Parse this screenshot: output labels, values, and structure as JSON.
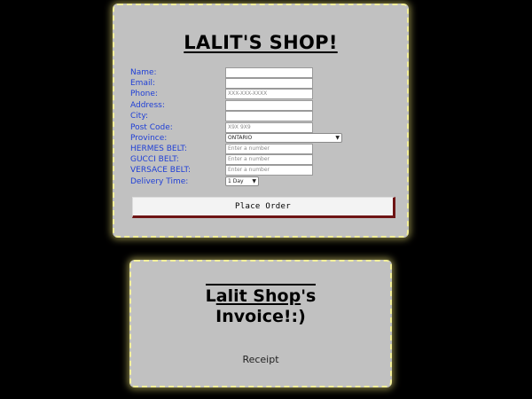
{
  "order_form": {
    "title": "LALIT'S SHOP!",
    "fields": [
      {
        "label": "Name:",
        "type": "text",
        "value": "",
        "placeholder": ""
      },
      {
        "label": "Email:",
        "type": "text",
        "value": "",
        "placeholder": ""
      },
      {
        "label": "Phone:",
        "type": "text",
        "value": "",
        "placeholder": "XXX-XXX-XXXX"
      },
      {
        "label": "Address:",
        "type": "text",
        "value": "",
        "placeholder": ""
      },
      {
        "label": "City:",
        "type": "text",
        "value": "",
        "placeholder": ""
      },
      {
        "label": "Post Code:",
        "type": "text",
        "value": "",
        "placeholder": "X9X 9X9"
      },
      {
        "label": "Province:",
        "type": "select",
        "value": "ONTARIO"
      },
      {
        "label": "HERMES BELT:",
        "type": "number",
        "value": "",
        "placeholder": "Enter a number"
      },
      {
        "label": "GUCCI BELT:",
        "type": "number",
        "value": "",
        "placeholder": "Enter a number"
      },
      {
        "label": "VERSACE BELT:",
        "type": "number",
        "value": "",
        "placeholder": "Enter a number"
      },
      {
        "label": "Delivery Time:",
        "type": "select",
        "value": "1 Day"
      }
    ],
    "submit_label": "Place Order"
  },
  "invoice": {
    "title_part1": "L",
    "title_part2": "alit Shop",
    "title_part3": "'s",
    "title_line2": "Invoice!:)",
    "receipt_label": "Receipt"
  },
  "colors": {
    "background": "#000000",
    "panel": "#c1c1c1",
    "panel_border": "#f2ef9a",
    "label_blue": "#1f3fd6",
    "button_shadow": "#6e1414"
  },
  "icons": {
    "select_arrow": "chevron-down-icon"
  }
}
